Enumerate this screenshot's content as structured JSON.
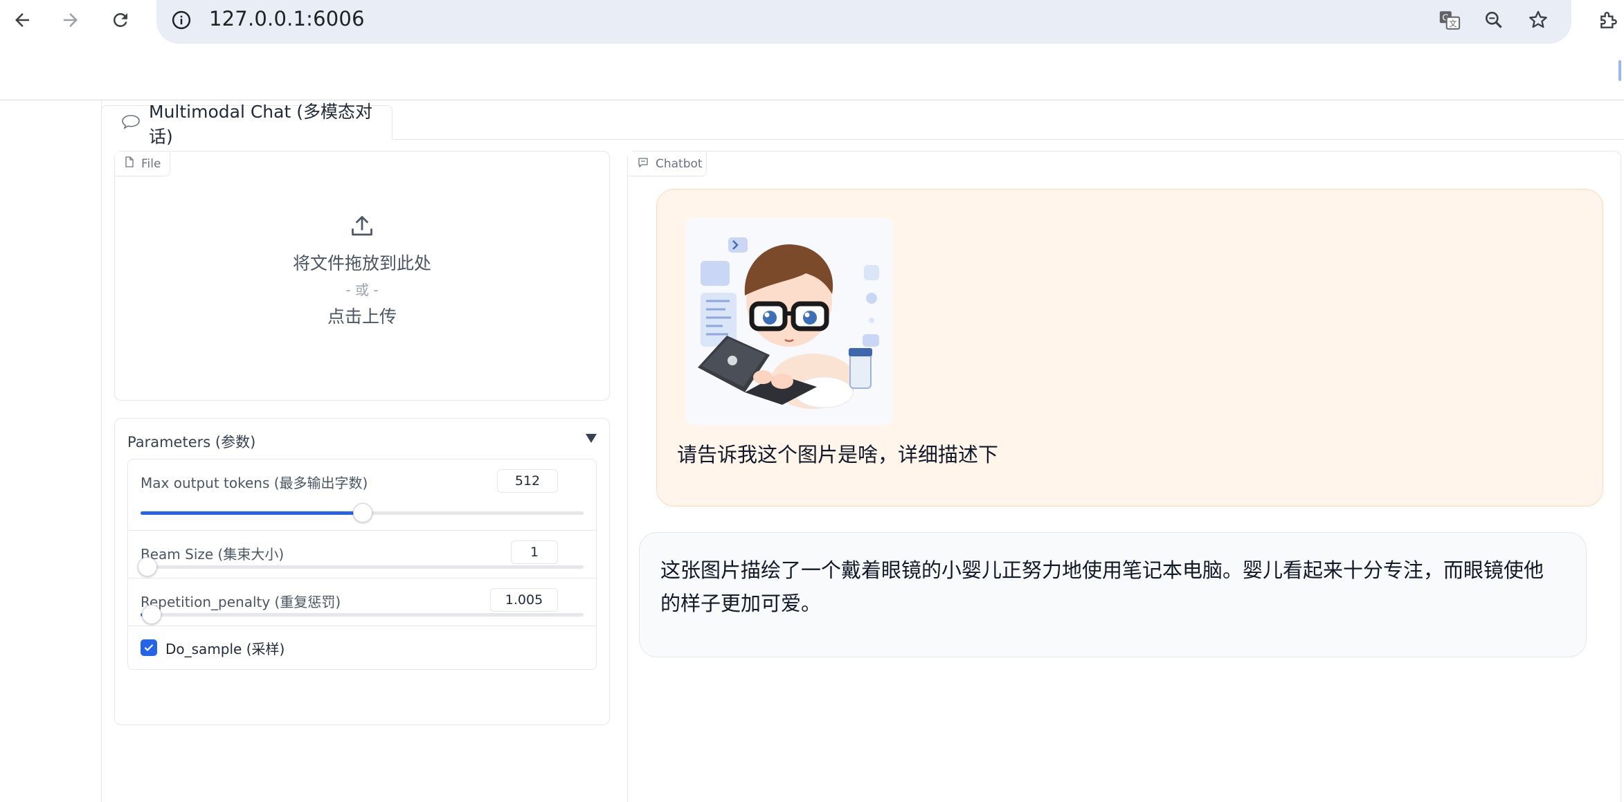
{
  "browser": {
    "url": "127.0.0.1:6006",
    "icons": [
      "back-arrow-icon",
      "forward-arrow-icon",
      "reload-icon",
      "site-info-icon",
      "translate-icon",
      "zoom-icon",
      "bookmark-star-icon",
      "extensions-icon"
    ]
  },
  "tabs": [
    {
      "label": "Multimodal Chat (多模态对话)",
      "icon": "chat-bubble-icon",
      "active": true
    }
  ],
  "file_block": {
    "tag": "File",
    "drop_text": "将文件拖放到此处",
    "or_text": "- 或 -",
    "click_text": "点击上传"
  },
  "parameters": {
    "title": "Parameters (参数)",
    "max_tokens": {
      "label": "Max output tokens (最多输出字数)",
      "value": "512",
      "fraction": 0.5
    },
    "beam_size": {
      "label": "Beam Size (集束大小)",
      "value": "1",
      "fraction": 0.0
    },
    "repetition_penalty": {
      "label": "Repetition_penalty (重复惩罚)",
      "value": "1.005",
      "fraction": 0.01
    },
    "do_sample": {
      "label": "Do_sample (采样)",
      "checked": true
    }
  },
  "chatbot": {
    "tag": "Chatbot",
    "user_message": "请告诉我这个图片是啥，详细描述下",
    "bot_message": "这张图片描绘了一个戴着眼镜的小婴儿正努力地使用笔记本电脑。婴儿看起来十分专注，而眼镜使他的样子更加可爱。"
  },
  "colors": {
    "accent": "#2563eb",
    "user_bubble_bg": "#fff5eb",
    "user_bubble_border": "#fcd9bd",
    "bot_bubble_bg": "#f9fafb"
  }
}
